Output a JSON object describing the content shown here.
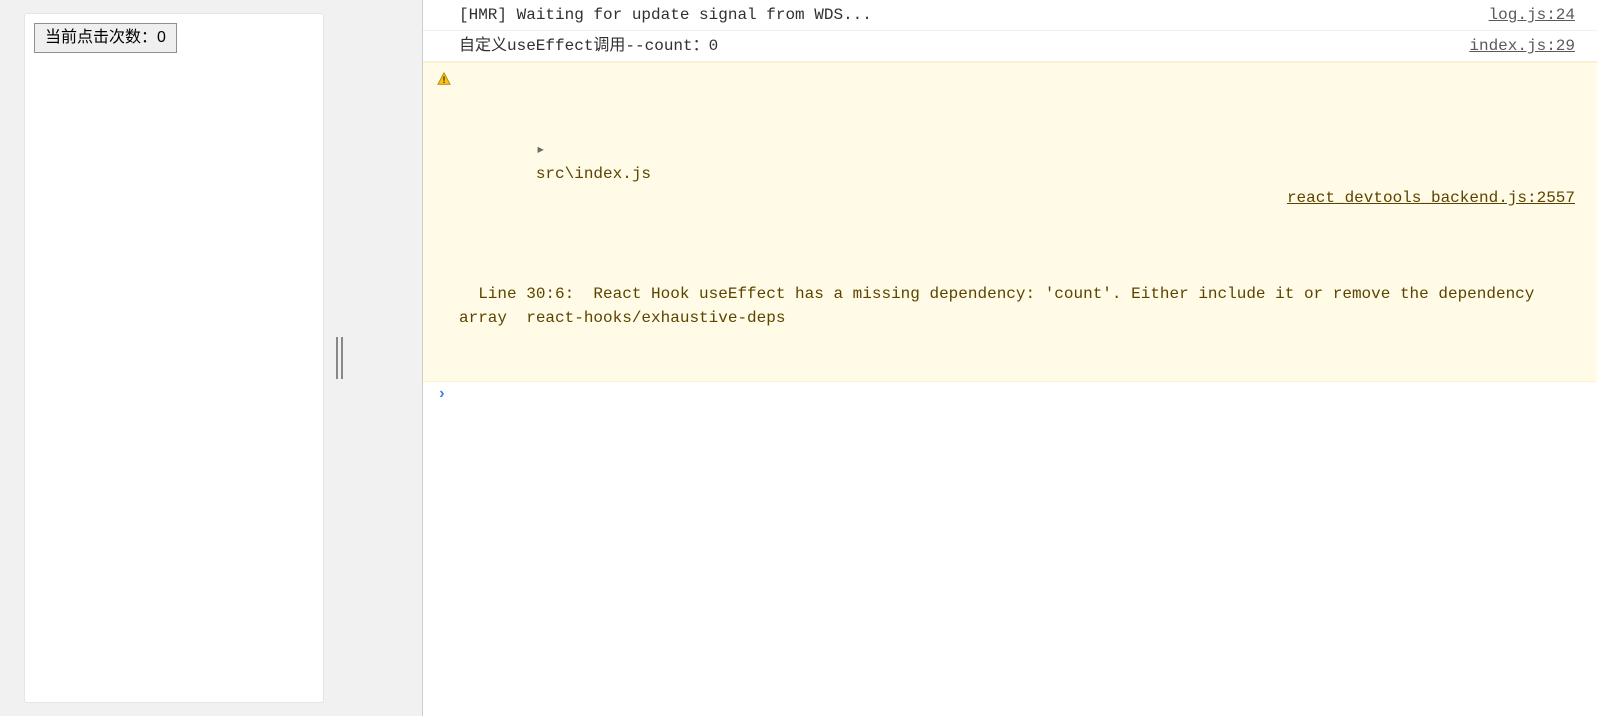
{
  "page": {
    "button_label": "当前点击次数：0"
  },
  "console": {
    "rows": [
      {
        "kind": "info",
        "text": "[HMR] Waiting for update signal from WDS...",
        "source": "log.js:24"
      },
      {
        "kind": "info",
        "text": "自定义useEffect调用--count：0",
        "source": "index.js:29"
      },
      {
        "kind": "warn",
        "file": "src\\index.js",
        "text": "  Line 30:6:  React Hook useEffect has a missing dependency: 'count'. Either include it or remove the dependency array  react-hooks/exhaustive-deps",
        "source": "react_devtools_backend.js:2557"
      }
    ],
    "prompt_chevron": "›"
  }
}
